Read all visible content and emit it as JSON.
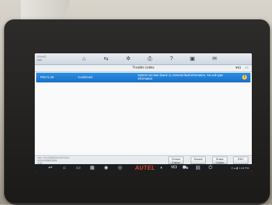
{
  "toolbar": {
    "vehicle_line1": "VOLVO",
    "vehicle_line2": "S80",
    "icons": [
      "home-icon",
      "vehicle-swap-icon",
      "settings-icon",
      "print-icon",
      "help-icon",
      "save-icon",
      "data-logging-icon"
    ]
  },
  "titlebar": {
    "title": "Trouble codes",
    "vci_label": "VCI",
    "battery": "▭"
  },
  "codes": [
    {
      "code": "P0171.00",
      "status": "Confirmed",
      "description": "System too lean (bank 1). General fault information. No sub type information"
    }
  ],
  "actionbar": {
    "vehicle_info": "VIN: YV1TS592XXXXXXXXX\nVOLVO/S80/2006\n2.5T",
    "buttons": {
      "freeze_frame": "Freeze Frame",
      "search": "Search",
      "erase_codes": "Erase Codes",
      "esc": "ESC"
    }
  },
  "navbar": {
    "brand": "AUTEL",
    "vci": "VCI",
    "status_text": "◷ ▴ ▮ 1:18 PM"
  }
}
